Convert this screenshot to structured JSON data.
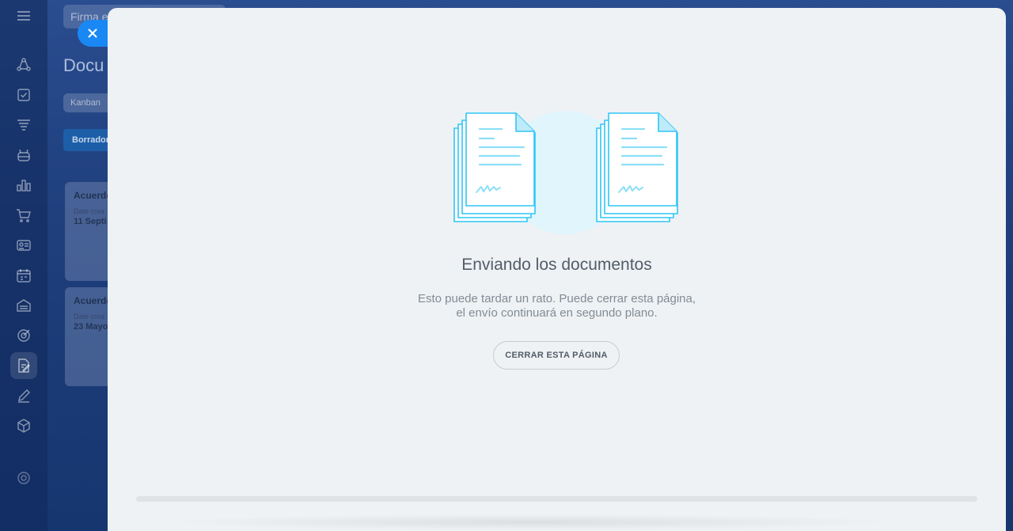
{
  "background": {
    "search_placeholder": "Firma e",
    "page_title": "Docu",
    "view_chip": "Kanban",
    "column_header": "Borrador",
    "cards": [
      {
        "title": "Acuerdo",
        "date_label": "Date crea",
        "date": "11 Septi"
      },
      {
        "title": "Acuerdo",
        "date_label": "Date crea",
        "date": "23 Mayo"
      }
    ]
  },
  "sidebar": {
    "icons": [
      "menu-icon",
      "crm-icon",
      "tasks-icon",
      "sales-funnel-icon",
      "robot-icon",
      "analytics-icon",
      "shop-icon",
      "contact-center-icon",
      "calendar-icon",
      "warehouse-icon",
      "target-icon",
      "sign-icon",
      "pen-icon",
      "cube-icon",
      "settings-icon"
    ]
  },
  "slider": {
    "close_icon": "close-icon",
    "heading": "Enviando los documentos",
    "description_line1": "Esto puede tardar un rato. Puede cerrar esta página,",
    "description_line2": "el envío continuará en segundo plano.",
    "close_page_button": "CERRAR ESTA PÁGINA",
    "progress": 0
  },
  "colors": {
    "accent": "#1a88f4",
    "panel_bg": "#eef2f4",
    "illustration_stroke": "#2fc6f6"
  }
}
